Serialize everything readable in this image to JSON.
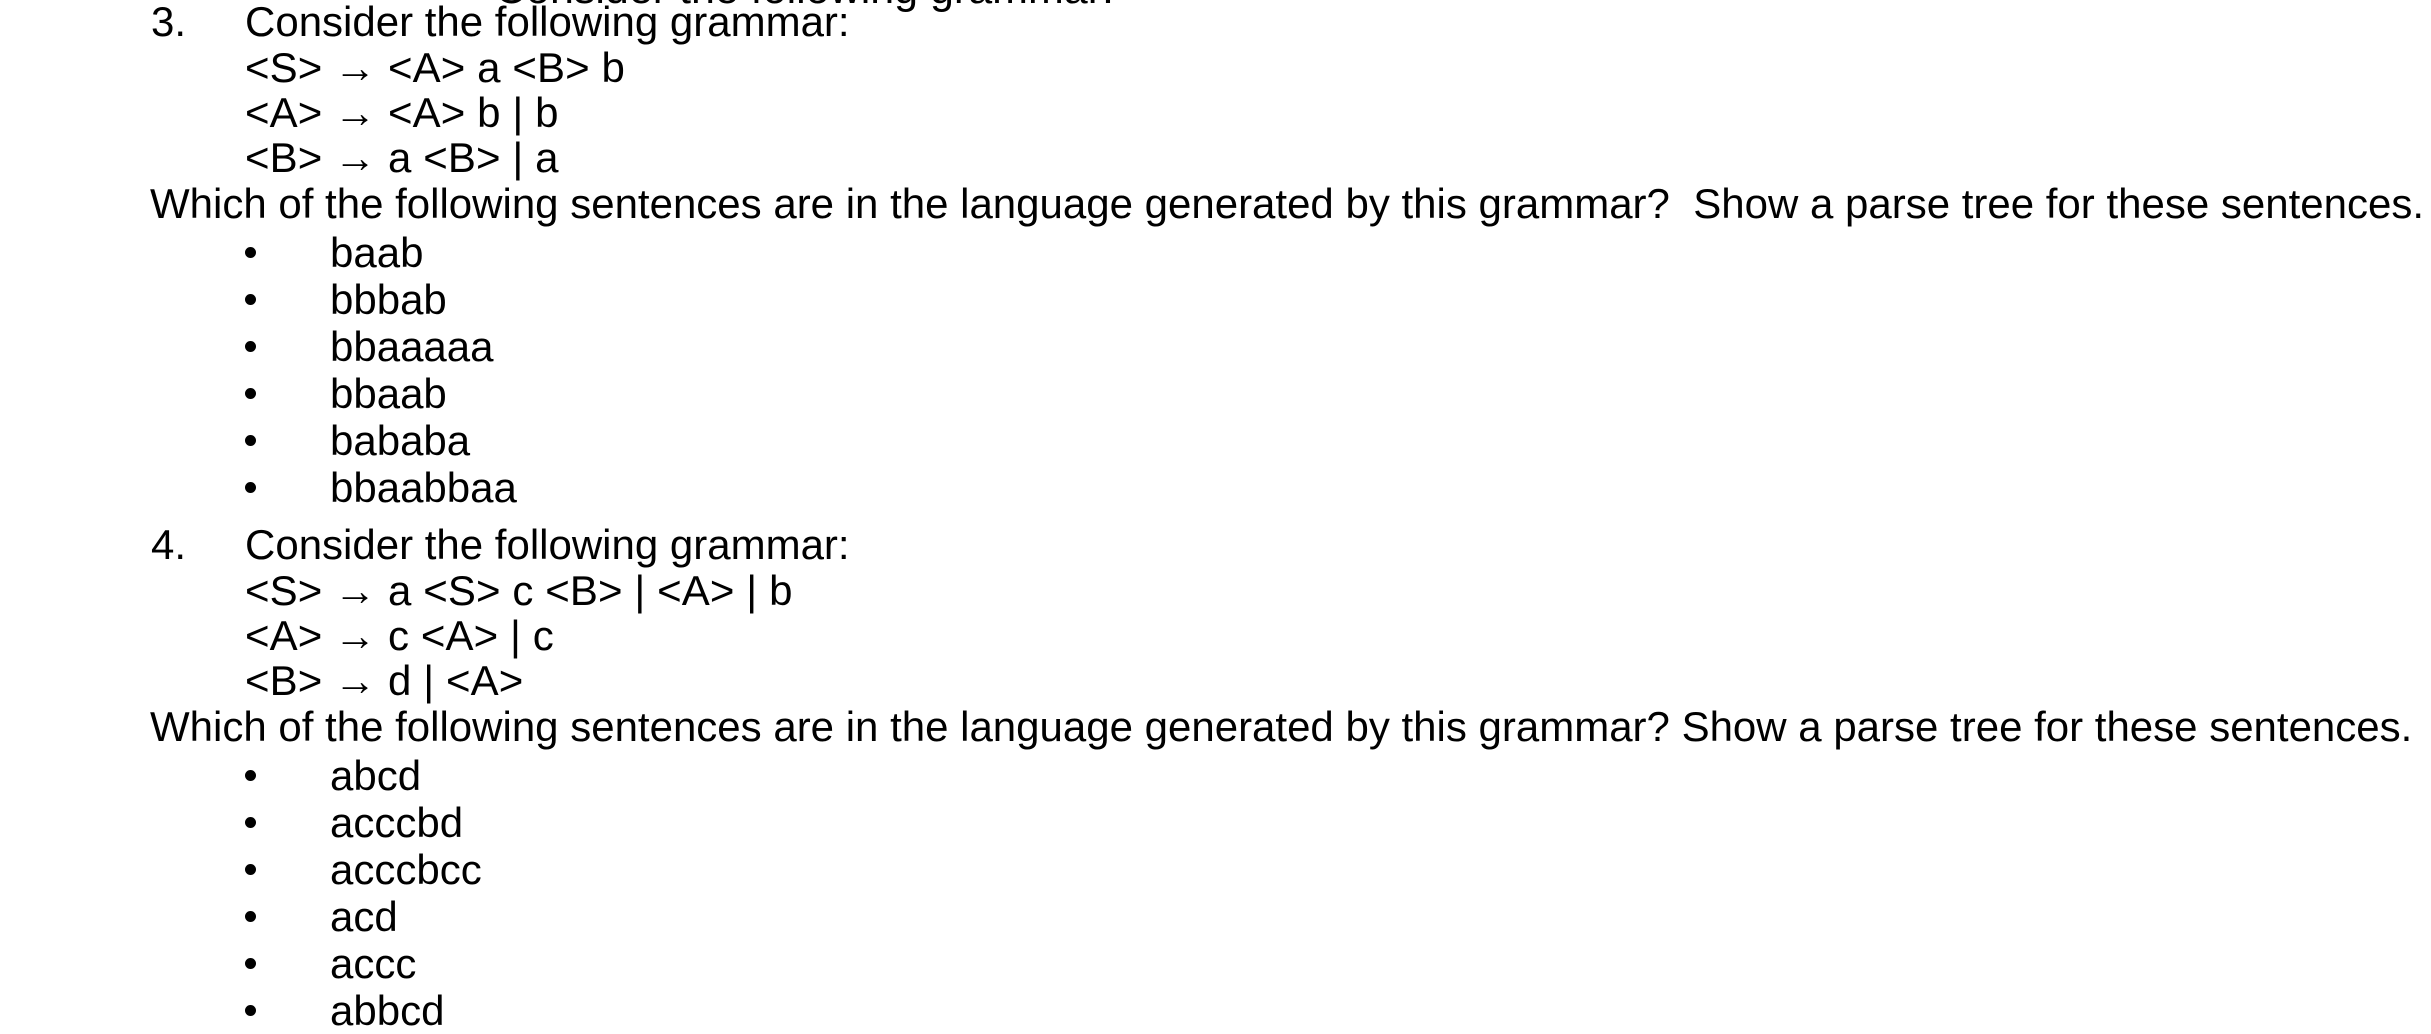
{
  "document": {
    "clipped_top_line": "Consider the following grammar:",
    "background_color": "#ffffff",
    "text_color": "#000000"
  },
  "exercises": [
    {
      "number": "3.",
      "title": "Consider the following grammar:",
      "rules": [
        "<S> → <A> a <B> b",
        "<A> → <A> b | b",
        "<B> → a <B> | a"
      ],
      "question": "Which of the following sentences are in the language generated by this grammar?  Show a parse tree for these sentences.",
      "bullets": [
        "baab",
        "bbbab",
        "bbaaaaa",
        "bbaab",
        "bababa",
        "bbaabbaa"
      ]
    },
    {
      "number": "4.",
      "title": "Consider the following grammar:",
      "rules": [
        "<S> → a <S> c <B> | <A> | b",
        "<A> → c <A> | c",
        "<B> → d | <A>"
      ],
      "question": "Which of the following sentences are in the language generated by this grammar? Show a parse tree for these sentences.",
      "bullets": [
        "abcd",
        "acccbd",
        "acccbcc",
        "acd",
        "accc",
        "abbcd"
      ]
    }
  ]
}
